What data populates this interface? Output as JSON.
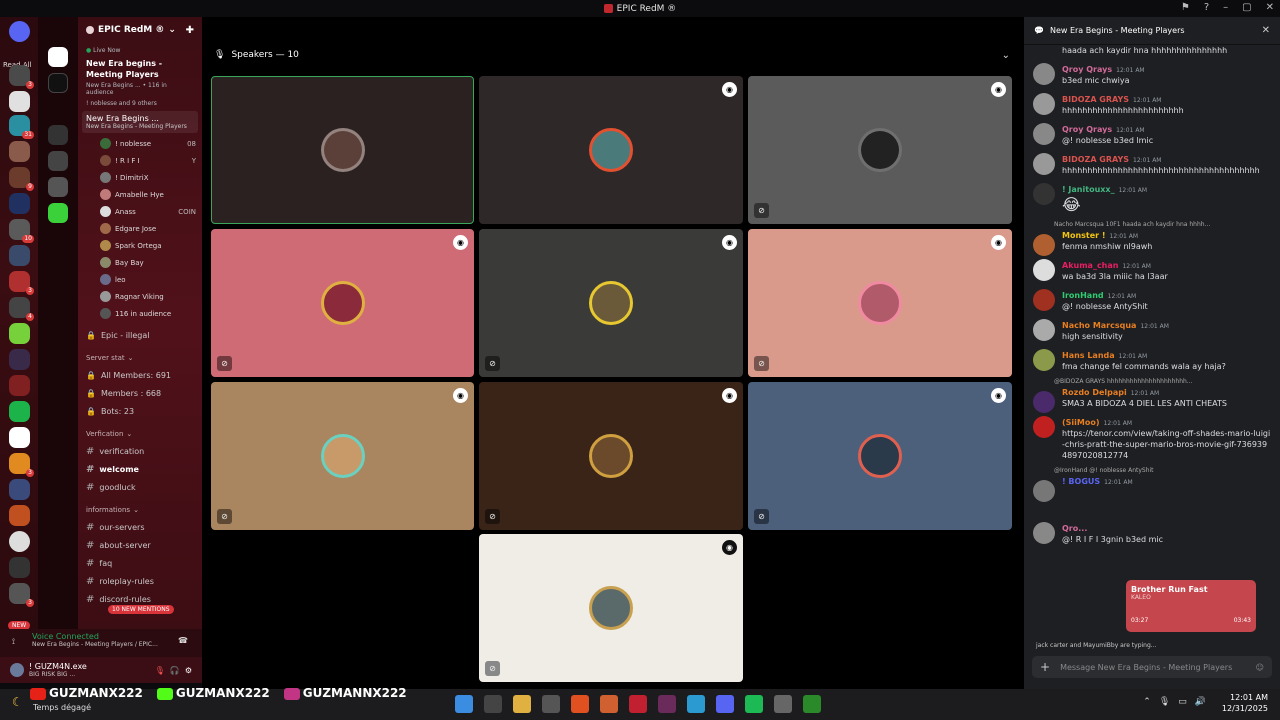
{
  "app": {
    "title": "EPIC RedM ®"
  },
  "guildbar": {
    "read_all": "Read All",
    "new_label": "NEW",
    "badges": [
      "3",
      "5",
      "31",
      "9",
      "10",
      "3",
      "4",
      "3",
      "3"
    ]
  },
  "sidebar": {
    "server_name": "EPIC RedM ®",
    "live_now": "Live Now",
    "event_title": "New Era begins - Meeting Players",
    "event_sub": "New Era Begins ... • 116 in audience",
    "event_users": "! noblesse and 9 others",
    "voice_channel": {
      "name": "New Era Begins ...",
      "sub": "New Era Begins - Meeting Players"
    },
    "members": [
      {
        "name": "! noblesse",
        "extra": "08"
      },
      {
        "name": "! R I F I",
        "extra": "Y"
      },
      {
        "name": "! DimitriX",
        "extra": ""
      },
      {
        "name": "Amabelle Hye",
        "extra": ""
      },
      {
        "name": "Anass",
        "extra": "COIN"
      },
      {
        "name": "Edgare Jose",
        "extra": ""
      },
      {
        "name": "Spark Ortega",
        "extra": ""
      },
      {
        "name": "Bay Bay",
        "extra": ""
      },
      {
        "name": "leo",
        "extra": ""
      },
      {
        "name": "Ragnar Viking",
        "extra": ""
      }
    ],
    "audience": "116 in audience",
    "locked_channel": "Epic - illegal",
    "cat_server_stat": "Server stat",
    "stats": [
      "All Members: 691",
      "Members : 668",
      "Bots: 23"
    ],
    "cat_verification": "Verfication",
    "verif_channels": [
      "verification",
      "welcome",
      "goodluck"
    ],
    "cat_informations": "informations",
    "info_channels": [
      "our-servers",
      "about-server",
      "faq",
      "roleplay-rules",
      "discord-rules"
    ],
    "mentions_pill": "10 NEW MENTIONS"
  },
  "voice_status": {
    "title": "Voice Connected",
    "sub": "New Era Begins - Meeting Players / EPIC..."
  },
  "user_panel": {
    "name": "! GUZM4N.exe",
    "status": "BIG RISK BIG ..."
  },
  "stage": {
    "speakers_label": "Speakers — 10",
    "tiles": [
      {
        "bg": "#2a2120",
        "border": "#3ba55c"
      },
      {
        "bg": "#2e2928",
        "border": ""
      },
      {
        "bg": "#5b5b5b",
        "border": ""
      },
      {
        "bg": "#cf6b74",
        "border": ""
      },
      {
        "bg": "#3a3a38",
        "border": ""
      },
      {
        "bg": "#d99a8c",
        "border": ""
      },
      {
        "bg": "#a98560",
        "border": ""
      },
      {
        "bg": "#3a2418",
        "border": ""
      },
      {
        "bg": "#4c607c",
        "border": ""
      },
      {
        "bg": "#efede6",
        "border": ""
      }
    ]
  },
  "chat": {
    "header": "New Era Begins - Meeting Players",
    "messages": [
      {
        "name": "",
        "color": "#dbdee1",
        "time": "",
        "text": "haada ach kaydir hna hhhhhhhhhhhhhhh",
        "reply": ""
      },
      {
        "name": "Qroy Qrays",
        "color": "#d16a9a",
        "time": "12:01 AM",
        "text": "b3ed mic chwiya",
        "reply": ""
      },
      {
        "name": "BIDOZA GRAYS",
        "color": "#d9534f",
        "time": "12:01 AM",
        "text": "hhhhhhhhhhhhhhhhhhhhhhhh",
        "reply": ""
      },
      {
        "name": "Qroy Qrays",
        "color": "#d16a9a",
        "time": "12:01 AM",
        "text": "@! noblesse b3ed lmic",
        "reply": ""
      },
      {
        "name": "BIDOZA GRAYS",
        "color": "#d9534f",
        "time": "12:01 AM",
        "text": "hhhhhhhhhhhhhhhhhhhhhhhhhhhhhhhhhhhhhhh",
        "reply": ""
      },
      {
        "name": "! Janitouxx_",
        "color": "#43b581",
        "time": "12:01 AM",
        "text": "😂",
        "reply": ""
      },
      {
        "name": "Monster !",
        "color": "#f1c40f",
        "time": "12:01 AM",
        "text": "fenma nmshiw nl9awh",
        "reply": "Nacho Marcsqua 10F1 haada ach kaydir hna hhhh..."
      },
      {
        "name": "Akuma_chan",
        "color": "#e91e63",
        "time": "12:01 AM",
        "text": "wa ba3d 3la miiic ha l3aar",
        "reply": ""
      },
      {
        "name": "IronHand",
        "color": "#2ecc71",
        "time": "12:01 AM",
        "text": "@! noblesse AntyShit",
        "reply": ""
      },
      {
        "name": "Nacho Marcsqua",
        "color": "#e67e22",
        "time": "12:01 AM",
        "text": "high sensitivity",
        "reply": ""
      },
      {
        "name": "Hans Landa",
        "color": "#e67e22",
        "time": "12:01 AM",
        "text": "fma change fel commands wala ay haja?",
        "reply": ""
      },
      {
        "name": "Rozdo Delpapi",
        "color": "#e67e22",
        "time": "12:01 AM",
        "text": "SMA3 A BIDOZA 4 DIEL LES ANTI CHEATS",
        "reply": "@BIDOZA GRAYS hhhhhhhhhhhhhhhhhhhhh..."
      },
      {
        "name": "(SiiMoo)",
        "color": "#e67e22",
        "time": "12:01 AM",
        "text": "https://tenor.com/view/taking-off-shades-mario-luigi-chris-pratt-the-super-mario-bros-movie-gif-7369394897020812774",
        "reply": ""
      },
      {
        "name": "! BOGUS",
        "color": "#5865f2",
        "time": "12:01 AM",
        "text": "",
        "reply": "@IronHand @! noblesse AntyShit"
      },
      {
        "name": "Qro...",
        "color": "#d16a9a",
        "time": "",
        "text": "@! R I F I 3gnin b3ed mic",
        "reply": ""
      }
    ],
    "now_playing": {
      "title": "Brother Run Fast",
      "artist": "KALEO",
      "elapsed": "03:27",
      "total": "03:43"
    },
    "typing": "jack carter and MayumiBby are typing...",
    "composer_placeholder": "Message New Era Begins - Meeting Players"
  },
  "taskbar": {
    "socials": [
      "GUZMANX222",
      "GUZMANX222",
      "GUZMANNX222"
    ],
    "weather": "Temps dégagé",
    "time": "12:01 AM",
    "date": "12/31/2025"
  }
}
